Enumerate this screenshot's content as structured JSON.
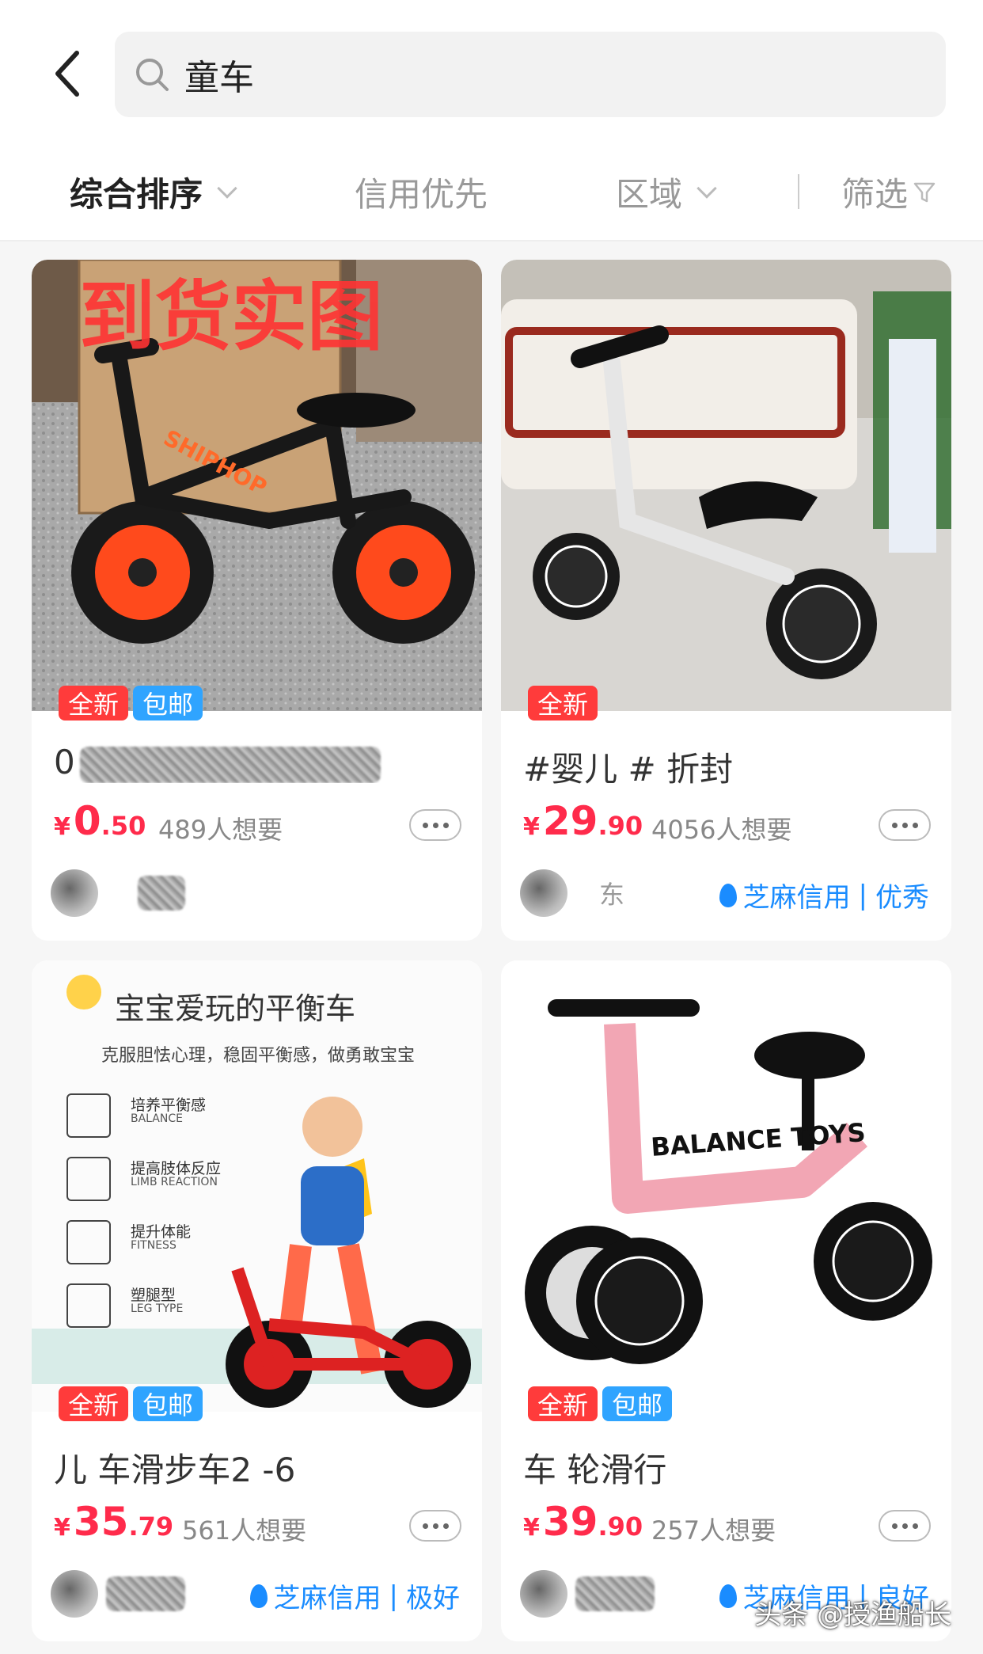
{
  "header": {
    "search_query": "童车"
  },
  "filters": [
    {
      "label": "综合排序",
      "active": true,
      "dropdown": true
    },
    {
      "label": "信用优先",
      "active": false,
      "dropdown": false
    },
    {
      "label": "区域",
      "active": false,
      "dropdown": true
    },
    {
      "label": "筛选",
      "active": false,
      "dropdown": false
    }
  ],
  "products": [
    {
      "image_caption": "到货实图",
      "brand_on_bike": "SHIPHOP",
      "tags": [
        "全新",
        "包邮"
      ],
      "title_visible": "0",
      "price_int": "0",
      "price_dec": ".50",
      "currency": "¥",
      "wants": "489人想要",
      "credit": ""
    },
    {
      "tags": [
        "全新"
      ],
      "title_visible": "#婴儿   #    折封",
      "price_int": "29",
      "price_dec": ".90",
      "currency": "¥",
      "wants": "4056人想要",
      "seller_name": "东",
      "credit_name": "芝麻信用",
      "credit_level": "优秀"
    },
    {
      "banner_title": "宝宝爱玩的平衡车",
      "banner_subtitle": "克服胆怯心理，稳固平衡感，做勇敢宝宝",
      "features": [
        {
          "cn": "培养平衡感",
          "en": "BALANCE"
        },
        {
          "cn": "提高肢体反应",
          "en": "LIMB REACTION"
        },
        {
          "cn": "提升体能",
          "en": "FITNESS"
        },
        {
          "cn": "塑腿型",
          "en": "LEG TYPE"
        }
      ],
      "tags": [
        "全新",
        "包邮"
      ],
      "title_visible": "儿     车滑步车2  -6",
      "price_int": "35",
      "price_dec": ".79",
      "currency": "¥",
      "wants": "561人想要",
      "credit_name": "芝麻信用",
      "credit_level": "极好"
    },
    {
      "brand_on_bike": "BALANCE TOYS",
      "tags": [
        "全新",
        "包邮"
      ],
      "title_visible": "     车    轮滑行",
      "price_int": "39",
      "price_dec": ".90",
      "currency": "¥",
      "wants": "257人想要",
      "credit_name": "芝麻信用",
      "credit_level": "良好"
    }
  ],
  "watermark": "头条 @授渔船长",
  "colors": {
    "price": "#ff2b4b",
    "tag_new": "#ff3b3b",
    "tag_ship": "#2fa4ff",
    "credit": "#1a8cff"
  }
}
